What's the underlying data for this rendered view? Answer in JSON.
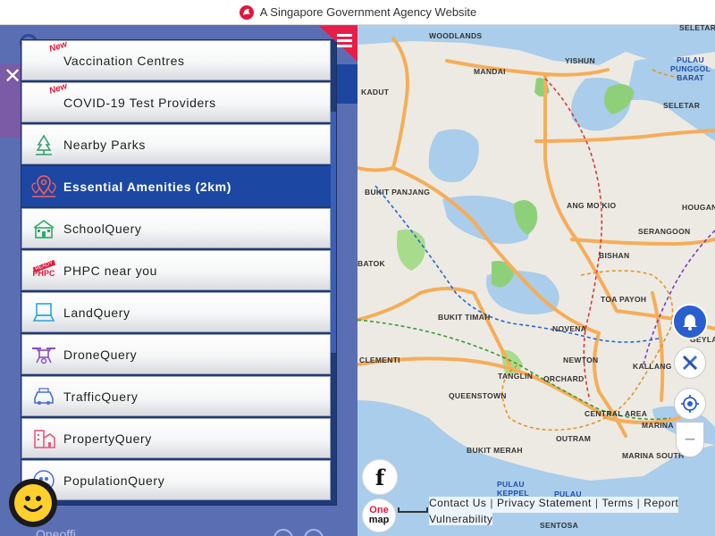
{
  "banner": {
    "text": "A Singapore Government Agency Website"
  },
  "menu": {
    "items": [
      {
        "label": "Vaccination Centres",
        "badge": "New",
        "icon": "syringe-icon"
      },
      {
        "label": "COVID-19 Test Providers",
        "badge": "New",
        "icon": "test-kit-icon"
      },
      {
        "label": "Nearby Parks",
        "icon": "park-tree-icon"
      },
      {
        "label": "Essential Amenities (2km)",
        "icon": "location-pins-icon",
        "active": true
      },
      {
        "label": "SchoolQuery",
        "icon": "school-icon"
      },
      {
        "label": "PHPC near you",
        "icon": "phpc-icon",
        "icon_text": "PHPC",
        "icon_tag": "READY"
      },
      {
        "label": "LandQuery",
        "icon": "land-map-icon"
      },
      {
        "label": "DroneQuery",
        "icon": "drone-icon"
      },
      {
        "label": "TrafficQuery",
        "icon": "traffic-car-icon"
      },
      {
        "label": "PropertyQuery",
        "icon": "property-building-icon"
      },
      {
        "label": "PopulationQuery",
        "icon": "population-icon"
      }
    ]
  },
  "left_pane": {
    "partial_text": "Oneoffi"
  },
  "map": {
    "labels": [
      {
        "text": "WOODLANDS"
      },
      {
        "text": "YISHUN"
      },
      {
        "text": "MANDAI"
      },
      {
        "text": "PULAU PUNGGOL BARAT",
        "blue": true
      },
      {
        "text": "SELETAR"
      },
      {
        "text": "KADUT"
      },
      {
        "text": "BUKIT PANJANG"
      },
      {
        "text": "ANG MO KIO"
      },
      {
        "text": "HOUGAN"
      },
      {
        "text": "SERANGOON"
      },
      {
        "text": "BATOK"
      },
      {
        "text": "BISHAN"
      },
      {
        "text": "TOA PAYOH"
      },
      {
        "text": "BUKIT TIMAH"
      },
      {
        "text": "NOVENA"
      },
      {
        "text": "GEYLA"
      },
      {
        "text": "CLEMENTI"
      },
      {
        "text": "NEWTON"
      },
      {
        "text": "KALLANG"
      },
      {
        "text": "TANGLIN"
      },
      {
        "text": "ORCHARD"
      },
      {
        "text": "QUEENSTOWN"
      },
      {
        "text": "CENTRAL AREA"
      },
      {
        "text": "MARINA"
      },
      {
        "text": "OUTRAM"
      },
      {
        "text": "BUKIT MERAH"
      },
      {
        "text": "MARINA SOUTH"
      },
      {
        "text": "PULAU KEPPEL",
        "blue": true
      },
      {
        "text": "PULAU BRANI",
        "blue": true
      },
      {
        "text": "SENTOSA"
      },
      {
        "text": "SELETAR"
      }
    ]
  },
  "footer": {
    "contact": "Contact Us",
    "privacy": "Privacy Statement",
    "terms": "Terms",
    "report": "Report",
    "vulnerability": "Vulnerability",
    "separator": "|"
  },
  "logo": {
    "one": "One",
    "map": "map"
  },
  "facebook": {
    "glyph": "f"
  },
  "zoom": {
    "out_symbol": "−"
  },
  "close": {
    "symbol": "✕"
  },
  "colors": {
    "primary": "#1c48a3",
    "badge": "#e3163a",
    "water": "#a9cdea",
    "road": "#f5ad59"
  }
}
